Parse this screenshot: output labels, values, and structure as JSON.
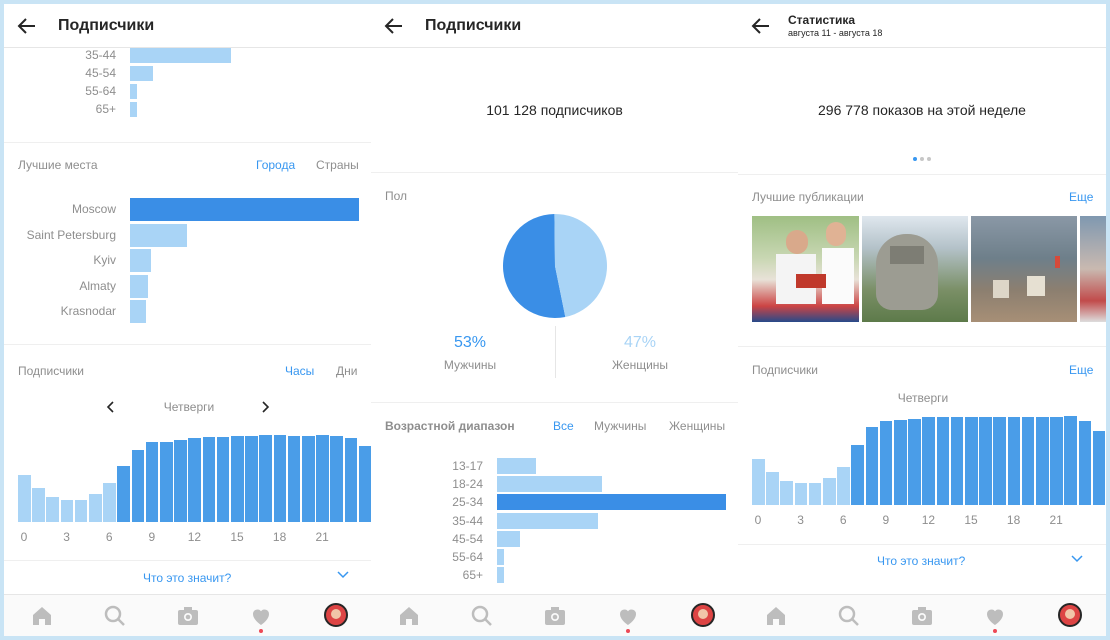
{
  "panel1": {
    "title": "Подписчики",
    "age_rows": [
      {
        "label": "35-44",
        "value": 0.44
      },
      {
        "label": "45-54",
        "value": 0.1
      },
      {
        "label": "55-64",
        "value": 0.03
      },
      {
        "label": "65+",
        "value": 0.03
      }
    ],
    "places": {
      "title": "Лучшие места",
      "tab_cities": "Города",
      "tab_countries": "Страны",
      "rows": [
        {
          "label": "Moscow",
          "value": 1.0
        },
        {
          "label": "Saint Petersburg",
          "value": 0.25
        },
        {
          "label": "Kyiv",
          "value": 0.09
        },
        {
          "label": "Almaty",
          "value": 0.08
        },
        {
          "label": "Krasnodar",
          "value": 0.07
        }
      ]
    },
    "followers": {
      "title": "Подписчики",
      "tab_hours": "Часы",
      "tab_days": "Дни",
      "day": "Четверги",
      "hours": [
        0.42,
        0.3,
        0.22,
        0.2,
        0.2,
        0.25,
        0.35,
        0.5,
        0.64,
        0.71,
        0.71,
        0.73,
        0.75,
        0.76,
        0.76,
        0.77,
        0.77,
        0.78,
        0.78,
        0.77,
        0.77,
        0.78,
        0.77,
        0.75,
        0.68
      ],
      "ticks": [
        "0",
        "3",
        "6",
        "9",
        "12",
        "15",
        "18",
        "21"
      ],
      "help": "Что это значит?"
    }
  },
  "panel2": {
    "title": "Подписчики",
    "count": "101 128 подписчиков",
    "gender": {
      "title": "Пол",
      "male_pct": "53%",
      "male_label": "Мужчины",
      "female_pct": "47%",
      "female_label": "Женщины",
      "male_value": 0.53,
      "female_value": 0.47
    },
    "age": {
      "title": "Возрастной диапазон",
      "tab_all": "Все",
      "tab_men": "Мужчины",
      "tab_women": "Женщины",
      "rows": [
        {
          "label": "13-17",
          "value": 0.17
        },
        {
          "label": "18-24",
          "value": 0.46
        },
        {
          "label": "25-34",
          "value": 1.0
        },
        {
          "label": "35-44",
          "value": 0.44
        },
        {
          "label": "45-54",
          "value": 0.1
        },
        {
          "label": "55-64",
          "value": 0.03
        },
        {
          "label": "65+",
          "value": 0.03
        }
      ]
    }
  },
  "panel3": {
    "title": "Статистика",
    "subtitle": "августа 11 - августа 18",
    "impressions": "296 778 показов на этой неделе",
    "top_posts": {
      "title": "Лучшие публикации",
      "more": "Еще"
    },
    "followers": {
      "title": "Подписчики",
      "more": "Еще",
      "day": "Четверги",
      "hours": [
        0.42,
        0.3,
        0.22,
        0.2,
        0.2,
        0.25,
        0.35,
        0.55,
        0.71,
        0.76,
        0.77,
        0.78,
        0.8,
        0.8,
        0.8,
        0.8,
        0.8,
        0.8,
        0.8,
        0.8,
        0.8,
        0.8,
        0.81,
        0.76,
        0.67
      ],
      "ticks": [
        "0",
        "3",
        "6",
        "9",
        "12",
        "15",
        "18",
        "21"
      ],
      "help": "Что это значит?"
    }
  },
  "colors": {
    "accent": "#3897f0",
    "bar_dark": "#3a8ee6",
    "bar_light": "#a9d4f6",
    "frame": "#c9e4f5",
    "notify": "#ed4956"
  },
  "nav_icons": [
    "home-icon",
    "search-icon",
    "camera-icon",
    "heart-icon",
    "profile-avatar"
  ]
}
